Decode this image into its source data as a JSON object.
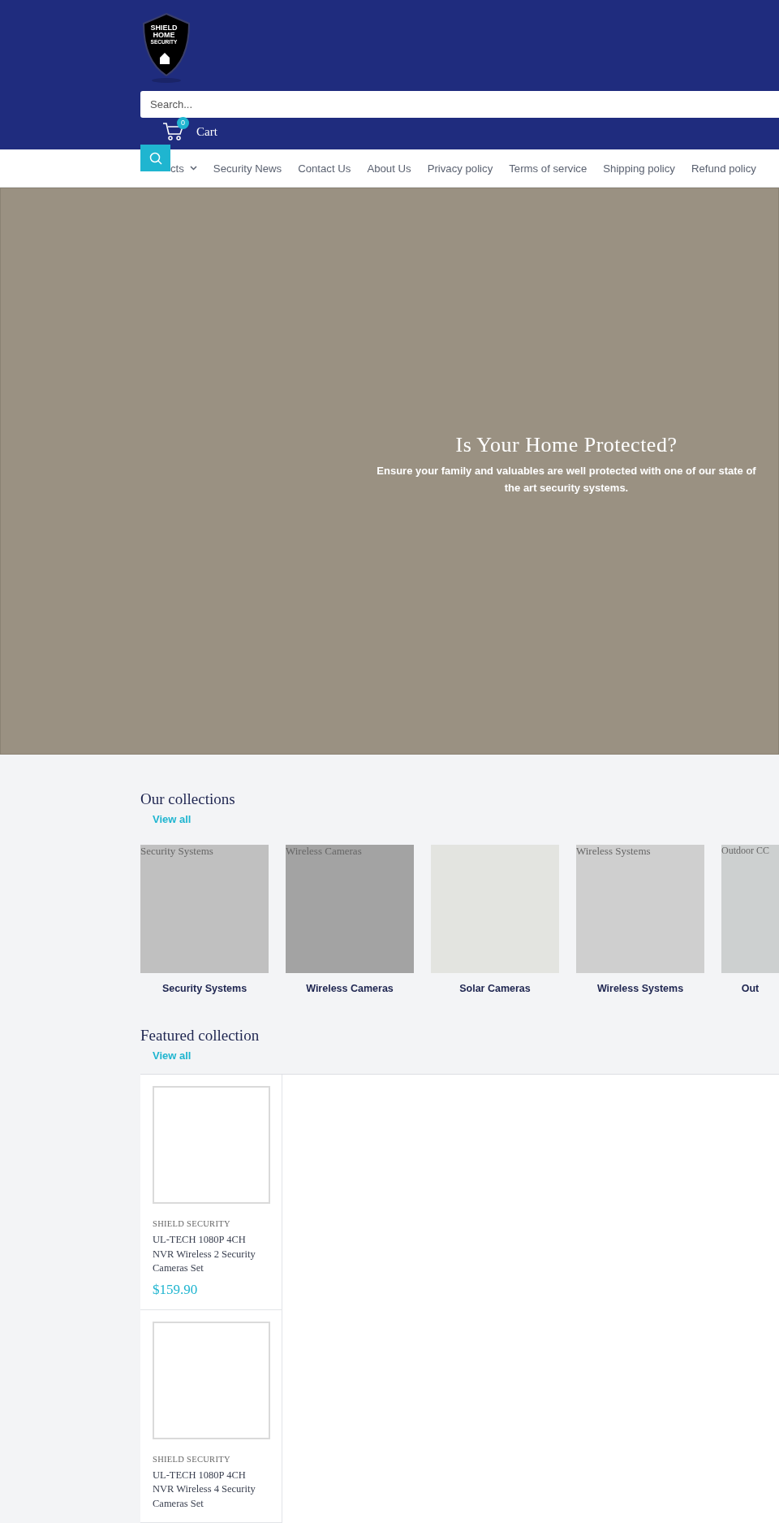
{
  "header": {
    "logo": {
      "lines": [
        "SHIELD",
        "HOME",
        "SECURITY"
      ]
    },
    "search": {
      "placeholder": "Search..."
    },
    "cart": {
      "count": "0",
      "label": "Cart"
    }
  },
  "nav": [
    {
      "label": "cts",
      "dropdown": true
    },
    {
      "label": "Security News",
      "dropdown": false
    },
    {
      "label": "Contact Us",
      "dropdown": false
    },
    {
      "label": "About Us",
      "dropdown": false
    },
    {
      "label": "Privacy policy",
      "dropdown": false
    },
    {
      "label": "Terms of service",
      "dropdown": false
    },
    {
      "label": "Shipping policy",
      "dropdown": false
    },
    {
      "label": "Refund policy",
      "dropdown": false
    }
  ],
  "hero": {
    "title": "Is Your Home Protected?",
    "subtitle": "Ensure your family and valuables are well protected with one of our state of the art security systems."
  },
  "collections": {
    "title": "Our collections",
    "view_all": "View all",
    "items": [
      {
        "alt": "Security Systems",
        "label": "Security Systems",
        "color": "#c0c0c0"
      },
      {
        "alt": "Wireless Cameras",
        "label": "Wireless Cameras",
        "color": "#a3a3a3"
      },
      {
        "label": "Solar Cameras",
        "color": "#e3e4e0"
      },
      {
        "alt": "Wireless Systems",
        "label": "Wireless Systems",
        "color": "#cfcfcf"
      },
      {
        "alt": "Outdoor CC",
        "label": "Out",
        "color": "#cdd0d0"
      }
    ]
  },
  "featured": {
    "title": "Featured collection",
    "view_all": "View all",
    "products": [
      {
        "brand": "SHIELD SECURITY",
        "title": "UL-TECH 1080P 4CH NVR Wireless 2 Security Cameras Set",
        "price": "$159.90"
      },
      {
        "brand": "SHIELD SECURITY",
        "title": "UL-TECH 1080P 4CH NVR Wireless 4 Security Cameras Set"
      }
    ]
  }
}
